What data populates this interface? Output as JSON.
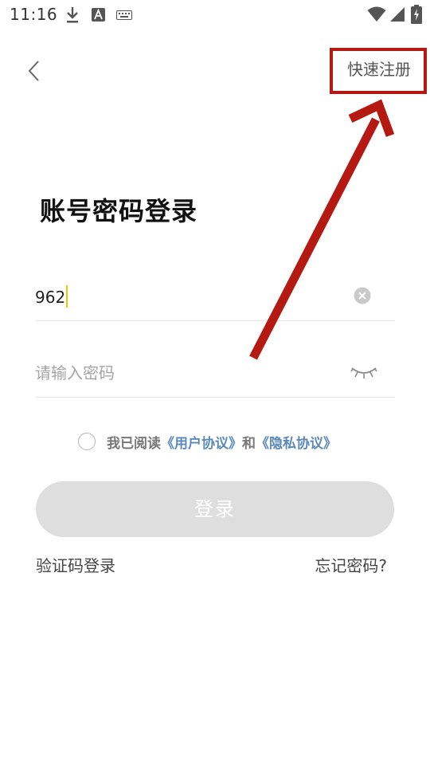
{
  "status_bar": {
    "time": "11:16",
    "icons": [
      "download-icon",
      "text-a-icon",
      "keyboard-icon",
      "wifi-icon",
      "signal-icon",
      "battery-icon"
    ]
  },
  "header": {
    "back_icon": "chevron-left-icon",
    "register_label": "快速注册"
  },
  "title": "账号密码登录",
  "account_field": {
    "value": "962",
    "clear_icon": "clear-icon"
  },
  "password_field": {
    "placeholder": "请输入密码",
    "eye_icon": "eye-closed-icon"
  },
  "agreement": {
    "prefix": "我已阅读",
    "user_agreement": "《用户协议》",
    "conjunction": "和",
    "privacy_policy": "《隐私协议》"
  },
  "login_button_label": "登录",
  "footer": {
    "sms_login": "验证码登录",
    "forgot_password": "忘记密码?"
  },
  "colors": {
    "annotation": "#b51a12",
    "link": "#5b8ab9",
    "button_disabled": "#dedede",
    "caret": "#f5c400"
  }
}
